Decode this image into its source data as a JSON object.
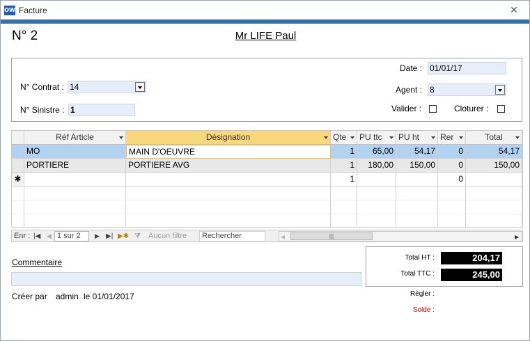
{
  "window": {
    "title": "Facture",
    "app_icon": "OW"
  },
  "invoice": {
    "number": "N°  2",
    "customer": "Mr LIFE Paul"
  },
  "header": {
    "date_label": "Date :",
    "date_value": "01/01/17",
    "contract_label": "N° Contrat :",
    "contract_value": "14",
    "agent_label": "Agent :",
    "agent_value": "8",
    "sinistre_label": "N° Sinistre :",
    "sinistre_value": "1",
    "valider_label": "Valider :",
    "cloturer_label": "Cloturer :"
  },
  "grid": {
    "columns": [
      "Réf Article",
      "Désignation",
      "Qte",
      "PU ttc",
      "PU ht",
      "Rer",
      "Total"
    ],
    "rows": [
      {
        "ref": "MO",
        "designation": "MAIN D'OEUVRE",
        "qte": "1",
        "pu_ttc": "65,00",
        "pu_ht": "54,17",
        "rer": "0",
        "total": "54,17"
      },
      {
        "ref": "PORTIERE",
        "designation": "PORTIERE AVG",
        "qte": "1",
        "pu_ttc": "180,00",
        "pu_ht": "150,00",
        "rer": "0",
        "total": "150,00"
      },
      {
        "ref": "",
        "designation": "",
        "qte": "1",
        "pu_ttc": "",
        "pu_ht": "",
        "rer": "0",
        "total": ""
      }
    ],
    "new_row_marker": "✱"
  },
  "navigator": {
    "label": "Enr :",
    "position": "1 sur 2",
    "filter_label": "Aucun filtre",
    "search_label": "Rechercher"
  },
  "totals": {
    "ht_label": "Total HT :",
    "ht_value": "204,17",
    "ttc_label": "Total TTC :",
    "ttc_value": "245,00",
    "regler_label": "Règler :",
    "solde_label": "Solde :",
    "solde_color": "#cc0000"
  },
  "comment": {
    "label": "Commentaire",
    "value": ""
  },
  "footer": {
    "created_by_label": "Créer par",
    "created_by_user": "admin",
    "created_on": "le 01/01/2017"
  },
  "colors": {
    "accent_strip": "#3a6fa6",
    "field_bg": "#e8eef9",
    "active_header": "#f9d77b",
    "selected_row": "#b3d2f1"
  }
}
